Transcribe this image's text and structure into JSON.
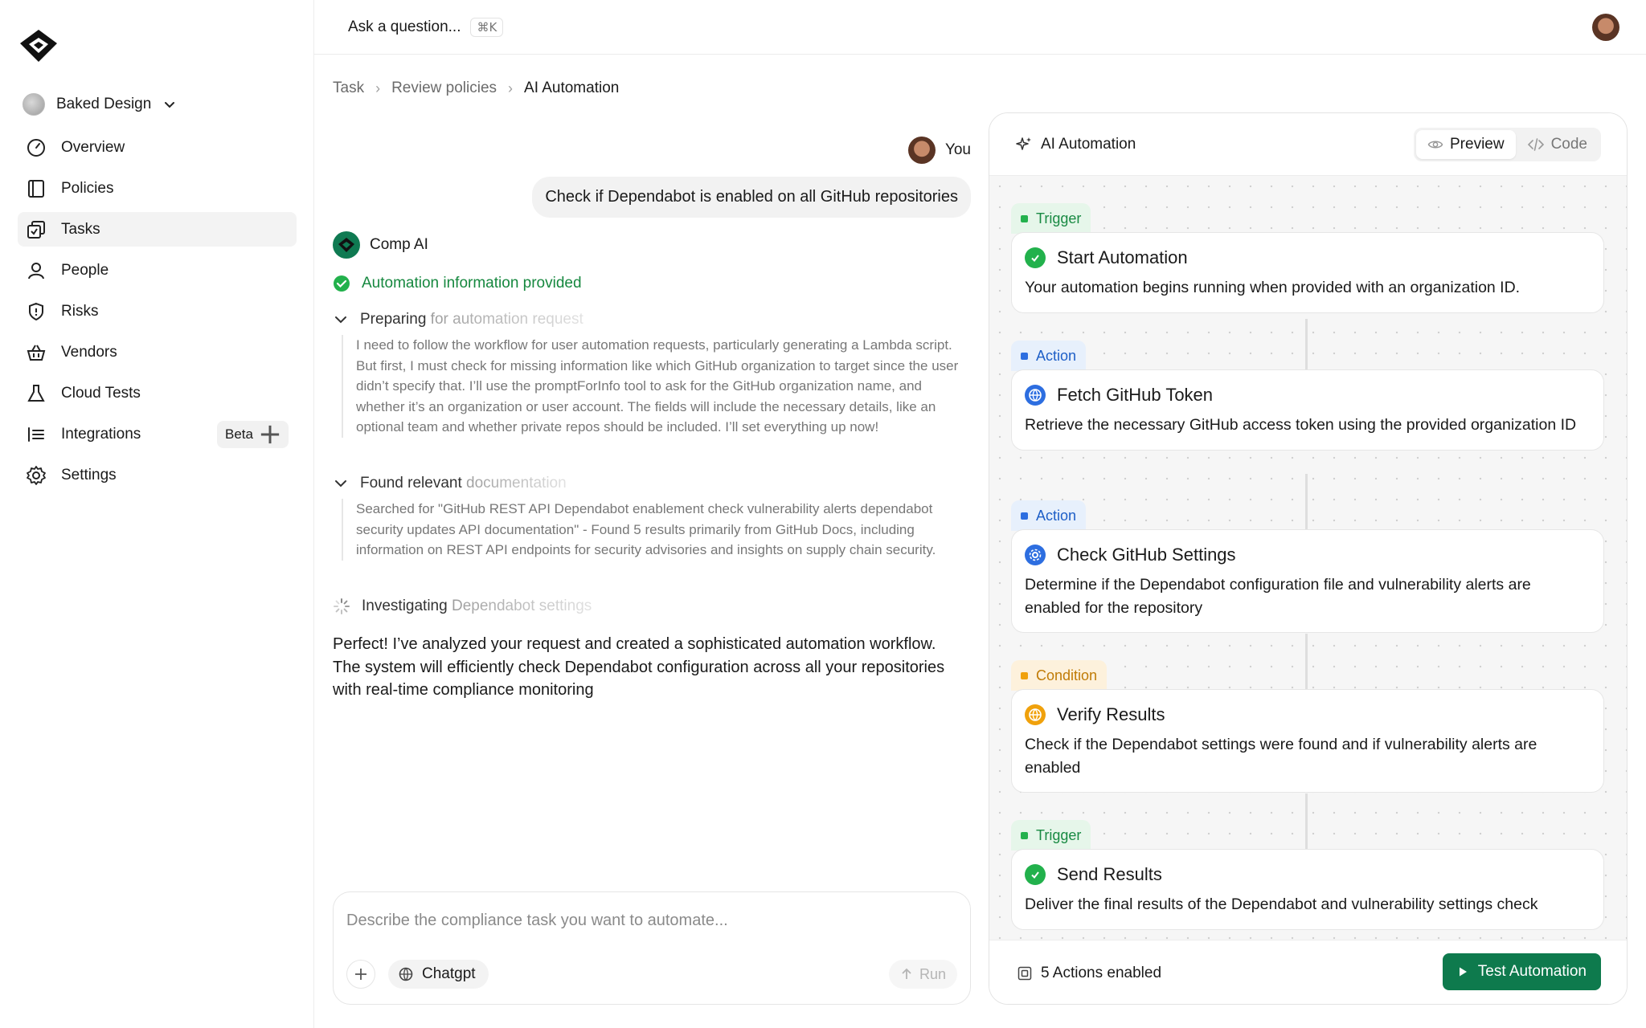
{
  "org": {
    "name": "Baked Design"
  },
  "nav": [
    {
      "label": "Overview",
      "icon": "gauge-icon"
    },
    {
      "label": "Policies",
      "icon": "book-icon"
    },
    {
      "label": "Tasks",
      "icon": "tasks-icon"
    },
    {
      "label": "People",
      "icon": "user-icon"
    },
    {
      "label": "Risks",
      "icon": "shield-icon"
    },
    {
      "label": "Vendors",
      "icon": "basket-icon"
    },
    {
      "label": "Cloud Tests",
      "icon": "flask-icon"
    },
    {
      "label": "Integrations",
      "icon": "integrations-icon",
      "badge": "Beta"
    },
    {
      "label": "Settings",
      "icon": "gear-icon"
    }
  ],
  "topbar": {
    "ask_label": "Ask a question...",
    "shortcut": "⌘K"
  },
  "breadcrumb": [
    "Task",
    "Review policies",
    "AI Automation"
  ],
  "chat": {
    "user_name": "You",
    "user_message": "Check if Dependabot is enabled on all GitHub repositories",
    "assistant_name": "Comp AI",
    "status": "Automation information provided",
    "sections": [
      {
        "title_start": "Preparing",
        "title_rest": " for automation request",
        "body": "I need to follow the workflow for user automation requests, particularly generating a Lambda script. But first, I must check for missing information like which GitHub organization to target since the user didn’t specify that. I’ll use the promptForInfo tool to ask for the GitHub organization name, and whether it’s an organization or user account. The fields will include the necessary details, like an optional team and whether private repos should be included. I’ll set everything up now!"
      },
      {
        "title_start": "Found relevant",
        "title_rest": " documentation",
        "body": "Searched for \"GitHub REST API Dependabot enablement check vulnerability alerts dependabot security updates API documentation\" - Found 5 results primarily from GitHub Docs, including information on REST API endpoints for security advisories and insights on supply chain security."
      }
    ],
    "investigating": {
      "title_start": "Investigating",
      "title_rest": " Dependabot settings"
    },
    "final_message": "Perfect! I’ve analyzed your request and created a sophisticated automation workflow. The system will efficiently check Dependabot configuration across all your repositories with real-time compliance monitoring"
  },
  "composer": {
    "placeholder": "Describe the compliance task you want to automate...",
    "model": "Chatgpt",
    "run_label": "Run"
  },
  "panel": {
    "title": "AI Automation",
    "tabs": [
      "Preview",
      "Code"
    ],
    "active_tab": "Preview",
    "nodes": [
      {
        "tag": "Trigger",
        "kind": "trigger",
        "title": "Start Automation",
        "icon": "check-circle-icon",
        "desc": "Your automation begins running when provided with an organization ID."
      },
      {
        "tag": "Action",
        "kind": "action",
        "title": "Fetch GitHub Token",
        "icon": "globe-icon",
        "desc": "Retrieve the necessary GitHub access token using the provided organization ID"
      },
      {
        "tag": "Action",
        "kind": "action",
        "title": "Check GitHub Settings",
        "icon": "gear-icon",
        "desc": "Determine if the Dependabot configuration file and vulnerability alerts are enabled for the repository"
      },
      {
        "tag": "Condition",
        "kind": "condition",
        "title": "Verify Results",
        "icon": "globe-icon",
        "desc": "Check if the Dependabot settings were found and if vulnerability alerts are enabled"
      },
      {
        "tag": "Trigger",
        "kind": "trigger",
        "title": "Send Results",
        "icon": "check-circle-icon",
        "desc": "Deliver the final results of the Dependabot and vulnerability settings check"
      }
    ],
    "footer": {
      "actions_label": "5 Actions enabled",
      "test_button": "Test Automation"
    }
  },
  "colors": {
    "accent": "#0e7a4d",
    "success": "#16883f",
    "trigger": "#23b14d",
    "action": "#2d6ee0",
    "condition": "#f0a10c"
  }
}
